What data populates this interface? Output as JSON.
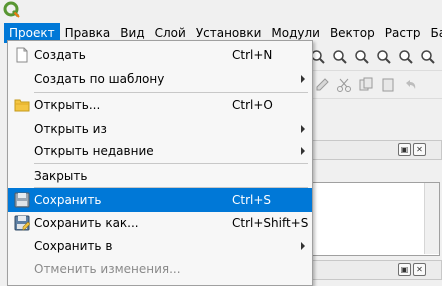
{
  "menubar": {
    "items": [
      {
        "label": "Проект",
        "active": true
      },
      {
        "label": "Правка"
      },
      {
        "label": "Вид"
      },
      {
        "label": "Слой"
      },
      {
        "label": "Установки"
      },
      {
        "label": "Модули"
      },
      {
        "label": "Вектор"
      },
      {
        "label": "Растр"
      },
      {
        "label": "База"
      }
    ]
  },
  "project_menu": {
    "new": {
      "label": "Создать",
      "shortcut": "Ctrl+N"
    },
    "new_from_template": {
      "label": "Создать по шаблону"
    },
    "open": {
      "label": "Открыть...",
      "shortcut": "Ctrl+O"
    },
    "open_from": {
      "label": "Открыть из"
    },
    "open_recent": {
      "label": "Открыть недавние"
    },
    "close": {
      "label": "Закрыть"
    },
    "save": {
      "label": "Сохранить",
      "shortcut": "Ctrl+S"
    },
    "save_as": {
      "label": "Сохранить как...",
      "shortcut": "Ctrl+Shift+S"
    },
    "save_to": {
      "label": "Сохранить в"
    },
    "revert": {
      "label": "Отменить изменения..."
    }
  },
  "colors": {
    "accent": "#0078d7",
    "menu_bg": "#f7f7f7",
    "disabled_text": "#8a8a8a",
    "logo_green": "#589632",
    "folder_yellow": "#f4c542"
  }
}
